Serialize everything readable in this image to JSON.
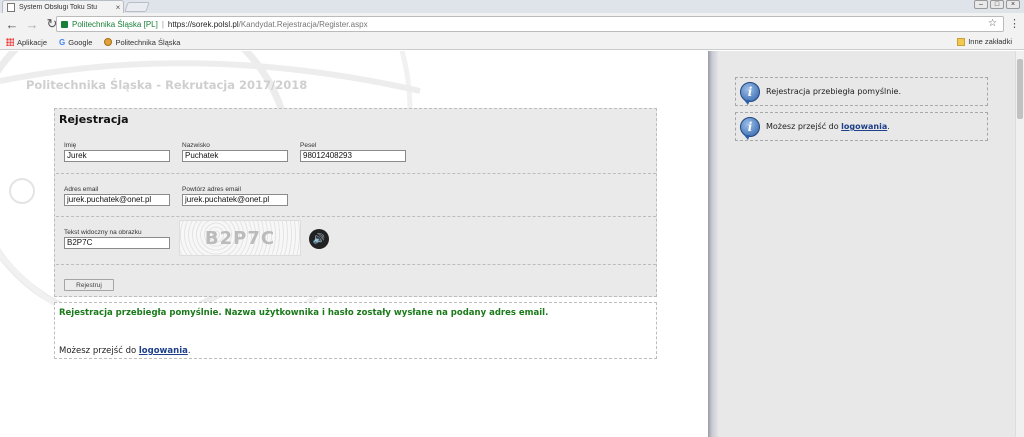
{
  "browser": {
    "tab_title": "System Obsługi Toku Stu",
    "tab_close": "×",
    "security_label": "Politechnika Śląska [PL]",
    "url_host": "https://sorek.polsl.pl",
    "url_path": "/Kandydat.Rejestracja/Register.aspx",
    "bookmarks": {
      "apps": "Aplikacje",
      "google": "Google",
      "polsl": "Politechnika Śląska",
      "other": "Inne zakładki"
    }
  },
  "page": {
    "site_title": "Politechnika Śląska - Rekrutacja 2017/2018",
    "form": {
      "title": "Rejestracja",
      "first_name": {
        "label": "Imię",
        "value": "Jurek"
      },
      "last_name": {
        "label": "Nazwisko",
        "value": "Puchatek"
      },
      "pesel": {
        "label": "Pesel",
        "value": "98012408293"
      },
      "email": {
        "label": "Adres email",
        "value": "jurek.puchatek@onet.pl"
      },
      "email_repeat": {
        "label": "Powtórz adres email",
        "value": "jurek.puchatek@onet.pl"
      },
      "captcha_input": {
        "label": "Tekst widoczny na obrazku",
        "value": "B2P7C"
      },
      "captcha_image_text": "B2P7C",
      "submit_label": "Rejestruj"
    },
    "result": {
      "success_message": "Rejestracja przebiegła pomyślnie. Nazwa użytkownika i hasło zostały wysłane na podany adres email.",
      "goto_prefix": "Możesz przejść do ",
      "goto_link": "logowania",
      "goto_suffix": "."
    }
  },
  "sidebar": {
    "messages": [
      {
        "text": "Rejestracja przebiegła pomyślnie."
      },
      {
        "prefix": "Możesz przejść do ",
        "link": "logowania",
        "suffix": "."
      }
    ]
  }
}
